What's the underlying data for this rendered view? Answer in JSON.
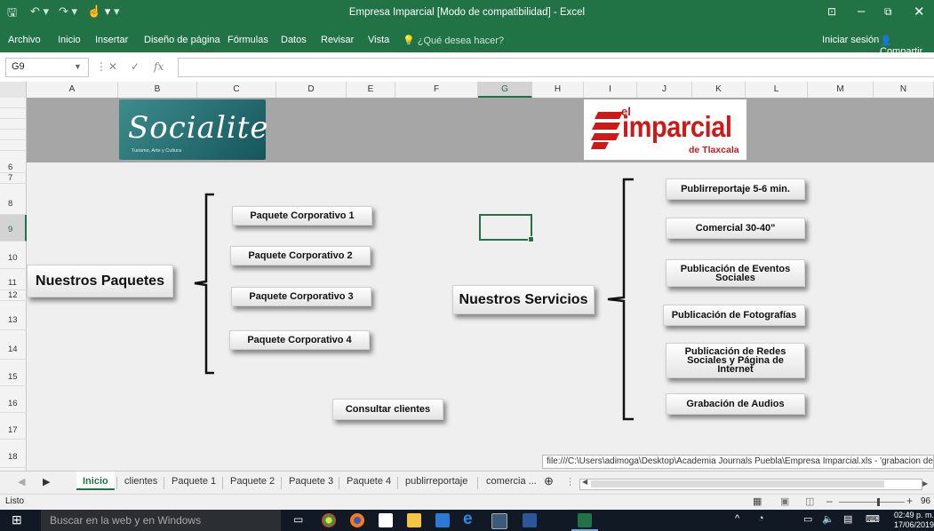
{
  "window": {
    "title": "Empresa Imparcial  [Modo de compatibilidad] - Excel"
  },
  "ribbon": {
    "tabs": [
      "Archivo",
      "Inicio",
      "Insertar",
      "Diseño de página",
      "Fórmulas",
      "Datos",
      "Revisar",
      "Vista"
    ],
    "search_placeholder": "¿Qué desea hacer?",
    "login": "Iniciar sesión",
    "share": "Compartir"
  },
  "formula_bar": {
    "name_box": "G9",
    "fx": "fx",
    "value": ""
  },
  "grid": {
    "columns": [
      "A",
      "B",
      "C",
      "D",
      "E",
      "F",
      "G",
      "H",
      "I",
      "J",
      "K",
      "L",
      "M",
      "N"
    ],
    "selected_column": "G",
    "rows": [
      "6",
      "7",
      "8",
      "9",
      "10",
      "11",
      "12",
      "13",
      "14",
      "15",
      "16",
      "17",
      "18"
    ],
    "selected_row": "9"
  },
  "logos": {
    "socialite": {
      "word": "Socialite",
      "tagline": "Turismo, Arte y Cultura"
    },
    "imparcial": {
      "el": "el",
      "name": "imparcial",
      "city": "de Tlaxcala"
    }
  },
  "content": {
    "left_title": "Nuestros Paquetes",
    "packages": [
      "Paquete Corporativo 1",
      "Paquete Corporativo 2",
      "Paquete Corporativo 3",
      "Paquete Corporativo 4"
    ],
    "clients_button": "Consultar clientes",
    "right_title": "Nuestros Servicios",
    "services": [
      "Publirreportaje 5-6 min.",
      "Comercial 30-40\"",
      "Publicación de Eventos Sociales",
      "Publicación de Fotografías",
      "Publicación de Redes Sociales y Página de Internet",
      "Grabación de Audios"
    ],
    "hyperlink_tooltip": "file:///C:\\Users\\adimoga\\Desktop\\Academia Journals Puebla\\Empresa Imparcial.xls - 'grabacion de audio'!"
  },
  "sheet_tabs": [
    "Inicio",
    "clientes",
    "Paquete 1",
    "Paquete 2",
    "Paquete 3",
    "Paquete 4",
    "publirreportaje",
    "comercia ..."
  ],
  "active_sheet": "Inicio",
  "status": {
    "ready": "Listo",
    "zoom": "96"
  },
  "taskbar": {
    "search_placeholder": "Buscar en la web y en Windows",
    "time": "02:49 p. m.",
    "date": "17/06/2019"
  }
}
